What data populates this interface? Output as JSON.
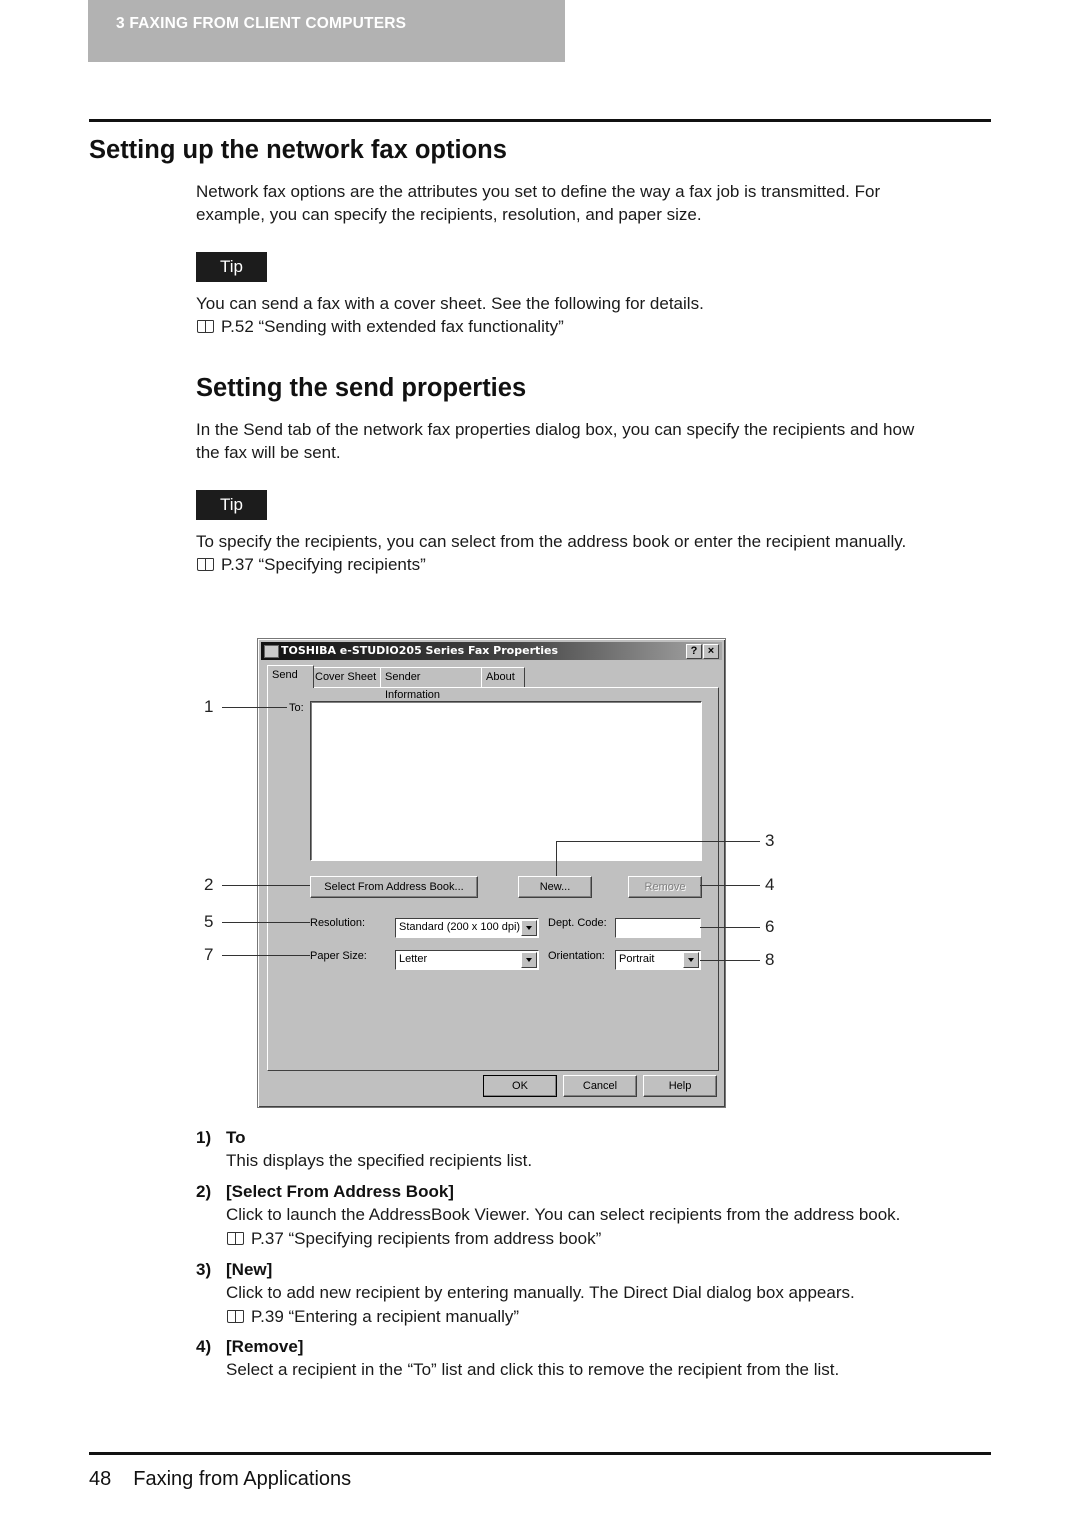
{
  "header": {
    "chapter_tab": "3   FAXING FROM CLIENT COMPUTERS"
  },
  "section": {
    "title": "Setting up the network fax options",
    "intro_line1": "Network fax options are the attributes you set to define the way a fax job is transmitted. For",
    "intro_line2": "example, you can specify the recipients, resolution, and paper size.",
    "tip1": {
      "label": "Tip",
      "text": "You can send a fax with a cover sheet. See the following for details.",
      "ref": "P.52 “Sending with extended fax functionality”"
    }
  },
  "subsection": {
    "title": "Setting the send properties",
    "intro_line1": "In the Send tab of the network fax properties dialog box, you can specify the recipients and how",
    "intro_line2": "the fax will be sent.",
    "tip2": {
      "label": "Tip",
      "text": "To specify the recipients, you can select from the address book or enter the recipient manually.",
      "ref": "P.37 “Specifying recipients”"
    }
  },
  "dialog": {
    "title": "TOSHIBA e-STUDIO205 Series Fax Properties",
    "help_button": "?",
    "close_button": "×",
    "tabs": [
      "Send",
      "Cover Sheet",
      "Sender Information",
      "About"
    ],
    "active_tab": "Send",
    "to_label": "To:",
    "select_address_book_button": "Select From Address Book...",
    "new_button": "New...",
    "remove_button": "Remove",
    "resolution_label": "Resolution:",
    "resolution_value": "Standard (200 x 100 dpi)",
    "dept_code_label": "Dept. Code:",
    "dept_code_value": "",
    "paper_size_label": "Paper Size:",
    "paper_size_value": "Letter",
    "orientation_label": "Orientation:",
    "orientation_value": "Portrait",
    "ok_button": "OK",
    "cancel_button": "Cancel",
    "help_footer_button": "Help"
  },
  "callouts": [
    "1",
    "2",
    "3",
    "4",
    "5",
    "6",
    "7",
    "8"
  ],
  "items": [
    {
      "num": "1)",
      "title": "To",
      "desc": "This displays the specified recipients list."
    },
    {
      "num": "2)",
      "title": "[Select From Address Book]",
      "desc": "Click to launch the AddressBook Viewer. You can select recipients from the address book.",
      "ref": "P.37 “Specifying recipients from address book”"
    },
    {
      "num": "3)",
      "title": "[New]",
      "desc": "Click to add new recipient by entering manually. The Direct Dial dialog box appears.",
      "ref": "P.39 “Entering a recipient manually”"
    },
    {
      "num": "4)",
      "title": "[Remove]",
      "desc": "Select a recipient in the “To” list and click this to remove the recipient from the list."
    }
  ],
  "footer": {
    "page_number": "48",
    "section_name": "Faxing from Applications"
  }
}
